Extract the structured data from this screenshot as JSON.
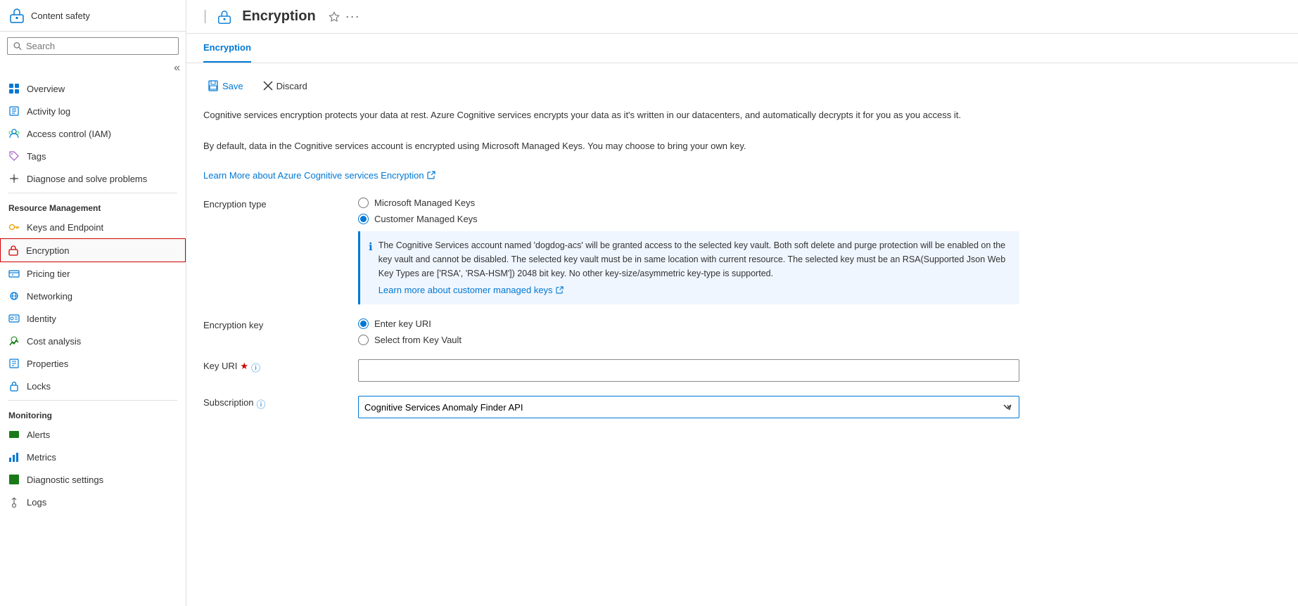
{
  "sidebar": {
    "app_icon": "🔒",
    "app_name": "Content safety",
    "search_placeholder": "Search",
    "collapse_icon": "«",
    "nav_items": [
      {
        "id": "overview",
        "label": "Overview",
        "icon": "grid"
      },
      {
        "id": "activity-log",
        "label": "Activity log",
        "icon": "log"
      },
      {
        "id": "access-control",
        "label": "Access control (IAM)",
        "icon": "iam"
      },
      {
        "id": "tags",
        "label": "Tags",
        "icon": "tag"
      },
      {
        "id": "diagnose",
        "label": "Diagnose and solve problems",
        "icon": "wrench"
      }
    ],
    "resource_management_label": "Resource Management",
    "resource_items": [
      {
        "id": "keys-endpoint",
        "label": "Keys and Endpoint",
        "icon": "key"
      },
      {
        "id": "encryption",
        "label": "Encryption",
        "icon": "encryption",
        "active": true,
        "highlighted": true
      },
      {
        "id": "pricing-tier",
        "label": "Pricing tier",
        "icon": "pricing"
      },
      {
        "id": "networking",
        "label": "Networking",
        "icon": "network"
      },
      {
        "id": "identity",
        "label": "Identity",
        "icon": "identity"
      },
      {
        "id": "cost-analysis",
        "label": "Cost analysis",
        "icon": "cost"
      },
      {
        "id": "properties",
        "label": "Properties",
        "icon": "properties"
      },
      {
        "id": "locks",
        "label": "Locks",
        "icon": "locks"
      }
    ],
    "monitoring_label": "Monitoring",
    "monitoring_items": [
      {
        "id": "alerts",
        "label": "Alerts",
        "icon": "alerts"
      },
      {
        "id": "metrics",
        "label": "Metrics",
        "icon": "metrics"
      },
      {
        "id": "diagnostic-settings",
        "label": "Diagnostic settings",
        "icon": "diagnostic"
      },
      {
        "id": "logs",
        "label": "Logs",
        "icon": "logs"
      }
    ]
  },
  "page": {
    "title": "Encryption",
    "tab_label": "Encryption",
    "toolbar": {
      "save_label": "Save",
      "discard_label": "Discard"
    },
    "description1": "Cognitive services encryption protects your data at rest. Azure Cognitive services encrypts your data as it's written in our datacenters, and automatically decrypts it for you as you access it.",
    "description2": "By default, data in the Cognitive services account is encrypted using Microsoft Managed Keys. You may choose to bring your own key.",
    "learn_more_label": "Learn More about Azure Cognitive services Encryption",
    "encryption_type_label": "Encryption type",
    "encryption_type_options": [
      {
        "id": "microsoft-managed",
        "label": "Microsoft Managed Keys",
        "checked": false
      },
      {
        "id": "customer-managed",
        "label": "Customer Managed Keys",
        "checked": true
      }
    ],
    "info_box_text": "The Cognitive Services account named 'dogdog-acs' will be granted access to the selected key vault. Both soft delete and purge protection will be enabled on the key vault and cannot be disabled. The selected key vault must be in same location with current resource. The selected key must be an RSA(Supported Json Web Key Types are ['RSA', 'RSA-HSM']) 2048 bit key. No other key-size/asymmetric key-type is supported.",
    "learn_more_cmk_label": "Learn more about customer managed keys",
    "encryption_key_label": "Encryption key",
    "encryption_key_options": [
      {
        "id": "enter-key-uri",
        "label": "Enter key URI",
        "checked": true
      },
      {
        "id": "select-key-vault",
        "label": "Select from Key Vault",
        "checked": false
      }
    ],
    "key_uri_label": "Key URI",
    "key_uri_required": true,
    "key_uri_value": "",
    "subscription_label": "Subscription",
    "subscription_value": "Cognitive Services Anomaly Finder API",
    "subscription_options": [
      "Cognitive Services Anomaly Finder API"
    ]
  }
}
